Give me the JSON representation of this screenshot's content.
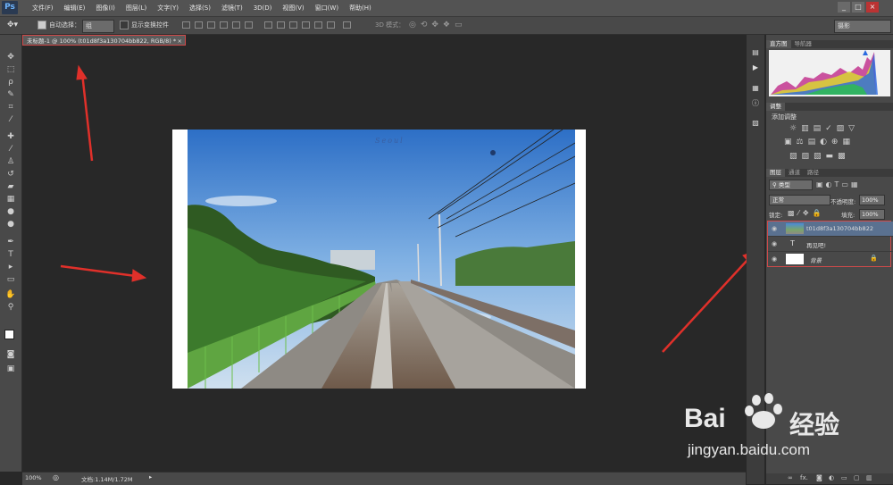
{
  "app": {
    "logo": "Ps"
  },
  "menu": [
    "文件(F)",
    "编辑(E)",
    "图像(I)",
    "图层(L)",
    "文字(Y)",
    "选择(S)",
    "滤镜(T)",
    "3D(D)",
    "视图(V)",
    "窗口(W)",
    "帮助(H)"
  ],
  "window_controls": [
    "_",
    "□",
    "×"
  ],
  "options": {
    "auto_select_label": "自动选择：",
    "auto_select_value": "组",
    "show_transform_label": "显示变换控件",
    "mode_3d_label": "3D 模式：",
    "workspace": "摄影"
  },
  "document": {
    "tab_title": "未标题-1 @ 100% (t01d8f3a130704bb822, RGB/8) *",
    "tab_close": "×",
    "photo_caption": "Seoul"
  },
  "status": {
    "zoom": "100%",
    "doc_size": "文档:1.14M/1.72M"
  },
  "panels": {
    "top_tabs": [
      "直方图",
      "导航器"
    ],
    "adjust_tabs": [
      "调整"
    ],
    "adjust_title": "添加调整",
    "layer_tabs": [
      "图层",
      "通道",
      "路径"
    ],
    "filter_kind": "类型",
    "blend_mode": "正常",
    "opacity_label": "不透明度:",
    "opacity_value": "100%",
    "lock_label": "锁定:",
    "fill_label": "填充:",
    "fill_value": "100%",
    "layers": [
      {
        "name": "t01d8f3a130704bb822",
        "type": "image"
      },
      {
        "name": "再见吧!",
        "type": "text",
        "type_glyph": "T"
      },
      {
        "name": "背景",
        "type": "background"
      }
    ],
    "bottom_icons": [
      "link-icon",
      "fx-icon",
      "mask-icon",
      "adjustment-icon",
      "folder-icon",
      "new-layer-icon",
      "trash-icon"
    ],
    "bottom_labels": [
      "∞",
      "fx."
    ]
  },
  "watermark": {
    "brand": "Bai",
    "brand_suffix": "经验",
    "url": "jingyan.baidu.com"
  },
  "colors": {
    "highlight_red": "#d04a4a",
    "arrow_red": "#e0302a",
    "panel_bg": "#494949",
    "canvas_bg": "#282828"
  }
}
